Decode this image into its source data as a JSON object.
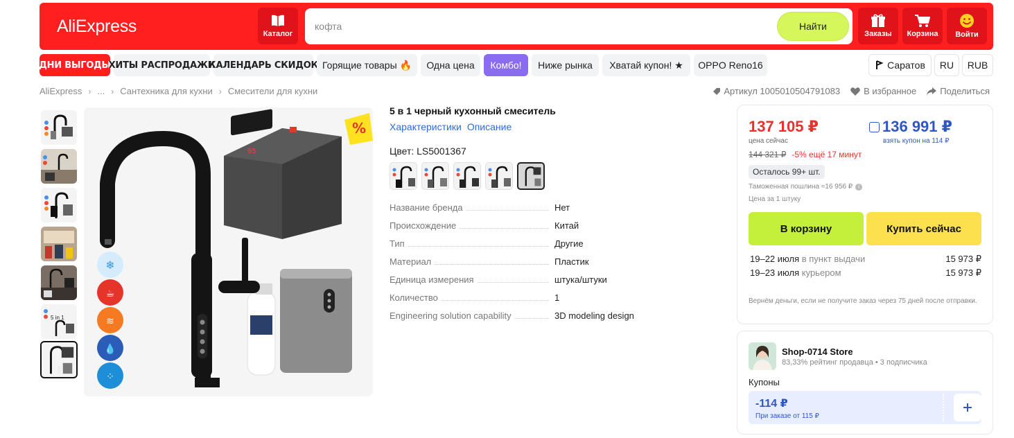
{
  "header": {
    "logo": "AliExpress",
    "catalog_label": "Каталог",
    "search_value": "",
    "search_placeholder": "кофта",
    "search_button": "Найти",
    "orders_label": "Заказы",
    "cart_label": "Корзина",
    "login_label": "Войти"
  },
  "promo": {
    "chips": [
      "ДНИ ВЫГОДЫ",
      "ХИТЫ РАСПРОДАЖИ",
      "КАЛЕНДАРЬ СКИДОК",
      "Горящие товары 🔥",
      "Одна цена",
      "Комбо!",
      "Ниже рынка",
      "Хватай купон! ★",
      "OPPO Reno16"
    ],
    "city": "Саратов",
    "lang": "RU",
    "currency": "RUB"
  },
  "breadcrumb": {
    "items": [
      "AliExpress",
      "...",
      "Сантехника для кухни",
      "Смесители для кухни"
    ],
    "article": "Артикул 1005010504791083",
    "favorite": "В избранное",
    "share": "Поделиться"
  },
  "product": {
    "title": "5 в 1 черный кухонный смеситель",
    "tab_specs": "Характеристики",
    "tab_desc": "Описание",
    "color_label": "Цвет: LS5001367",
    "badge": "%",
    "specs": [
      {
        "k": "Название бренда",
        "v": "Нет"
      },
      {
        "k": "Происхождение",
        "v": "Китай"
      },
      {
        "k": "Тип",
        "v": "Другие"
      },
      {
        "k": "Материал",
        "v": "Пластик"
      },
      {
        "k": "Единица измерения",
        "v": "штука/штуки"
      },
      {
        "k": "Количество",
        "v": "1"
      },
      {
        "k": "Engineering solution capability",
        "v": "3D modeling design"
      }
    ]
  },
  "buy": {
    "price": "137 105 ₽",
    "price_sub": "цена сейчас",
    "coupon_price": "136 991 ₽",
    "coupon_sub": "взять купон на 114 ₽",
    "old_price": "144 321 ₽",
    "discount": "-5% ещё 17 минут",
    "stock": "Осталось 99+ шт.",
    "duty": "Таможенная пошлина ≈16 956 ₽",
    "per_unit": "Цена за 1 штуку",
    "add_to_cart": "В корзину",
    "buy_now": "Купить сейчас",
    "delivery": [
      {
        "date": "19–22 июля",
        "way": "в пункт выдачи",
        "price": "15 973 ₽"
      },
      {
        "date": "19–23 июля",
        "way": "курьером",
        "price": "15 973 ₽"
      }
    ],
    "refund": "Вернём деньги, если не получите заказ через 75 дней после отправки."
  },
  "store": {
    "name": "Shop-0714 Store",
    "meta": "83,33% рейтинг продавца  •  3 подписчика",
    "coupons_label": "Купоны",
    "coupon_amount": "-114 ₽",
    "coupon_condition": "При заказе от 115 ₽"
  },
  "colors": {
    "brand_red": "#ff1f1f",
    "accent_green": "#c4f03c",
    "accent_yellow": "#fde04d",
    "price_red": "#e8312b",
    "link_blue": "#2f6ae0"
  }
}
